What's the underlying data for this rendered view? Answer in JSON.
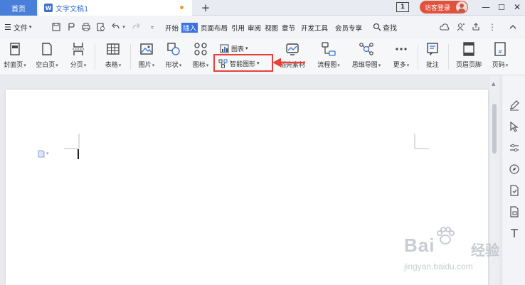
{
  "titlebar": {
    "home_tab": "首页",
    "doc_tab": "文字文稿1",
    "doc_icon_letter": "W",
    "new_tab": "+",
    "window_number": "1",
    "login_button": "访客登录",
    "minimize": "—",
    "maximize": "☐",
    "close": "✕"
  },
  "menubar": {
    "file_menu": "文件",
    "tabs": [
      {
        "label": "开始"
      },
      {
        "label": "插入"
      },
      {
        "label": "页面布局"
      },
      {
        "label": "引用"
      },
      {
        "label": "审阅"
      },
      {
        "label": "视图"
      },
      {
        "label": "章节"
      },
      {
        "label": "开发工具"
      },
      {
        "label": "会员专享"
      }
    ],
    "active_tab": "插入",
    "search_label": "查找"
  },
  "ribbon": {
    "items": [
      {
        "label": "封面页"
      },
      {
        "label": "空白页"
      },
      {
        "label": "分页"
      },
      {
        "label": "表格"
      },
      {
        "label": "图片"
      },
      {
        "label": "形状"
      },
      {
        "label": "图标"
      },
      {
        "label": "图表"
      },
      {
        "label": "智能图形"
      },
      {
        "label": "稻壳素材"
      },
      {
        "label": "流程图"
      },
      {
        "label": "思维导图"
      },
      {
        "label": "更多"
      },
      {
        "label": "批注"
      },
      {
        "label": "页眉页脚"
      },
      {
        "label": "页码"
      }
    ]
  },
  "highlight_color": "#e8403a",
  "accent_color": "#3a73e0",
  "watermark": {
    "brand": "Bai",
    "brand_cn": "经验",
    "url": "jingyan.baidu.com"
  }
}
